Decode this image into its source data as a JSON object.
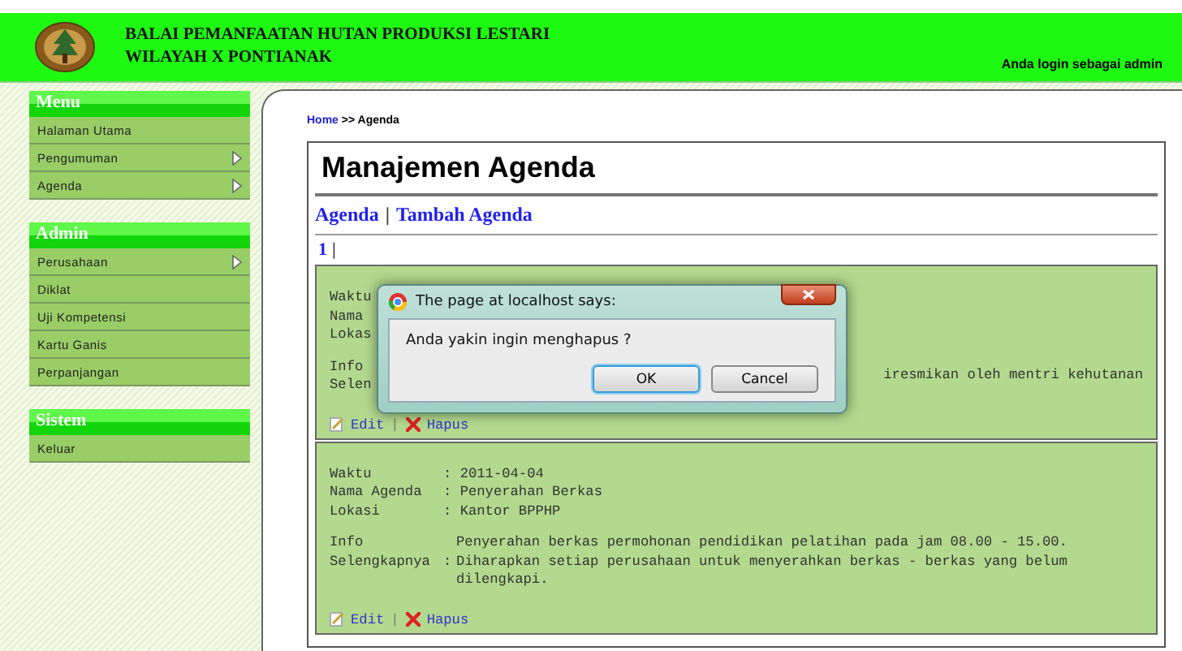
{
  "header": {
    "title_lines": [
      "BALAI PEMANFAATAN HUTAN PRODUKSI LESTARI",
      "WILAYAH X PONTIANAK"
    ],
    "login_text": "Anda login sebagai admin"
  },
  "sidebar": {
    "sections": [
      {
        "title": "Menu",
        "items": [
          {
            "label": "Halaman Utama",
            "submenu": false
          },
          {
            "label": "Pengumuman",
            "submenu": true
          },
          {
            "label": "Agenda",
            "submenu": true
          }
        ]
      },
      {
        "title": "Admin",
        "items": [
          {
            "label": "Perusahaan",
            "submenu": true
          },
          {
            "label": "Diklat",
            "submenu": false
          },
          {
            "label": "Uji Kompetensi",
            "submenu": false
          },
          {
            "label": "Kartu Ganis",
            "submenu": false
          },
          {
            "label": "Perpanjangan",
            "submenu": false
          }
        ]
      },
      {
        "title": "Sistem",
        "items": [
          {
            "label": "Keluar",
            "submenu": false
          }
        ]
      }
    ]
  },
  "breadcrumb": {
    "link": "Home",
    "current": ">> Agenda"
  },
  "page_title": "Manajemen Agenda",
  "links": [
    {
      "label": "Agenda"
    },
    {
      "label": "Tambah Agenda"
    }
  ],
  "link_separator": "|",
  "pagination": {
    "pages": [
      "1"
    ],
    "separator": "|"
  },
  "records": [
    {
      "covered": true,
      "rows": [
        {
          "label": [
            "Waktu"
          ],
          "value": ""
        },
        {
          "label": [
            "Nama"
          ],
          "value": ""
        },
        {
          "label": [
            "Lokas"
          ],
          "value": ""
        },
        {
          "label": [
            "Info",
            "Selen"
          ],
          "value": "iresmikan oleh mentri kehutanan"
        }
      ],
      "edit": "Edit",
      "separator": "|",
      "delete": "Hapus"
    },
    {
      "covered": false,
      "rows": [
        {
          "label": [
            "Waktu"
          ],
          "value": ": 2011-04-04"
        },
        {
          "label": [
            "Nama Agenda"
          ],
          "value": ": Penyerahan Berkas"
        },
        {
          "label": [
            "Lokasi"
          ],
          "value": ": Kantor BPPHP"
        },
        {
          "label": [
            "Info",
            "Selengkapnya"
          ],
          "value": "Penyerahan berkas permohonan pendidikan pelatihan pada jam 08.00 - 15.00. Diharapkan setiap perusahaan untuk menyerahkan berkas - berkas yang belum dilengkapi.",
          "colon": ":"
        }
      ],
      "edit": "Edit",
      "separator": "|",
      "delete": "Hapus"
    }
  ],
  "dialog": {
    "title": "The page at localhost says:",
    "message": "Anda yakin ingin menghapus ?",
    "buttons": [
      {
        "label": "OK",
        "selected": true
      },
      {
        "label": "Cancel",
        "selected": false
      }
    ]
  }
}
